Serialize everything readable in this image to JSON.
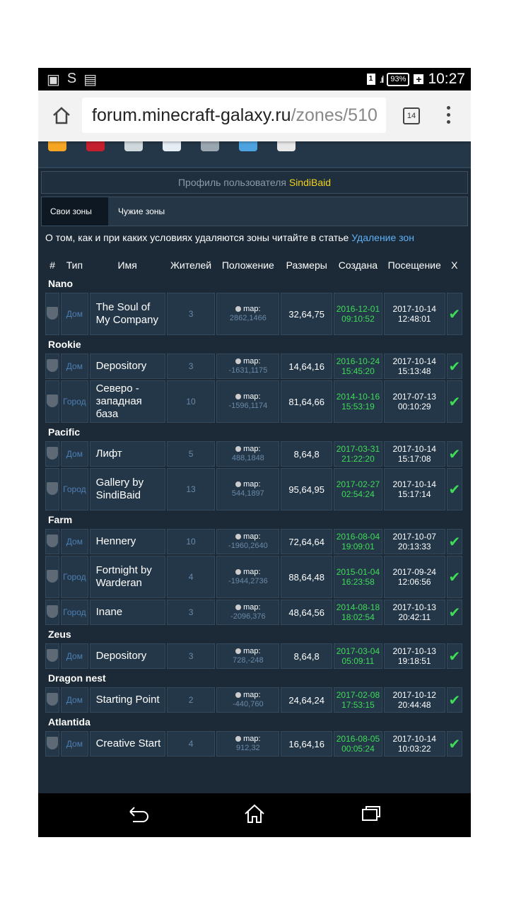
{
  "statusbar": {
    "battery": "93%",
    "time": "10:27",
    "sim": "1"
  },
  "browser": {
    "url_host": "forum.minecraft-galaxy.ru",
    "url_path": "/zones/510",
    "tab_count": "14"
  },
  "profile": {
    "prefix": "Профиль пользователя ",
    "username": "SindiBaid"
  },
  "tabs": {
    "own": "Свои зоны",
    "other": "Чужие зоны"
  },
  "notice": {
    "text": "О том, как и при каких условиях удаляются зоны читайте в статье ",
    "link": "Удаление зон"
  },
  "columns": {
    "num": "#",
    "type": "Тип",
    "name": "Имя",
    "residents": "Жителей",
    "position": "Положение",
    "size": "Размеры",
    "created": "Создана",
    "visit": "Посещение",
    "x": "X"
  },
  "groups": [
    {
      "name": "Nano",
      "zones": [
        {
          "type": "Дом",
          "name": "The Soul of My Company",
          "residents": "3",
          "pos_label": "map:",
          "pos_coord": "2862,1466",
          "size": "32,64,75",
          "created_date": "2016-12-01",
          "created_time": "09:10:52",
          "visit_date": "2017-10-14",
          "visit_time": "12:48:01"
        }
      ]
    },
    {
      "name": "Rookie",
      "zones": [
        {
          "type": "Дом",
          "name": "Depository",
          "residents": "3",
          "pos_label": "map:",
          "pos_coord": "-1631,1175",
          "size": "14,64,16",
          "created_date": "2016-10-24",
          "created_time": "15:45:20",
          "visit_date": "2017-10-14",
          "visit_time": "15:13:48"
        },
        {
          "type": "Город",
          "name": "Северо - западная база",
          "residents": "10",
          "pos_label": "map:",
          "pos_coord": "-1596,1174",
          "size": "81,64,66",
          "created_date": "2014-10-16",
          "created_time": "15:53:19",
          "visit_date": "2017-07-13",
          "visit_time": "00:10:29"
        }
      ]
    },
    {
      "name": "Pacific",
      "zones": [
        {
          "type": "Дом",
          "name": "Лифт",
          "residents": "5",
          "pos_label": "map:",
          "pos_coord": "488,1848",
          "size": "8,64,8",
          "created_date": "2017-03-31",
          "created_time": "21:22:20",
          "visit_date": "2017-10-14",
          "visit_time": "15:17:08"
        },
        {
          "type": "Город",
          "name": "Gallery by SindiBaid",
          "residents": "13",
          "pos_label": "map:",
          "pos_coord": "544,1897",
          "size": "95,64,95",
          "created_date": "2017-02-27",
          "created_time": "02:54:24",
          "visit_date": "2017-10-14",
          "visit_time": "15:17:14"
        }
      ]
    },
    {
      "name": "Farm",
      "zones": [
        {
          "type": "Дом",
          "name": "Hennery",
          "residents": "10",
          "pos_label": "map:",
          "pos_coord": "-1960,2640",
          "size": "72,64,64",
          "created_date": "2016-08-04",
          "created_time": "19:09:01",
          "visit_date": "2017-10-07",
          "visit_time": "20:13:33"
        },
        {
          "type": "Город",
          "name": "Fortnight by Warderan",
          "residents": "4",
          "pos_label": "map:",
          "pos_coord": "-1944,2736",
          "size": "88,64,48",
          "created_date": "2015-01-04",
          "created_time": "16:23:58",
          "visit_date": "2017-09-24",
          "visit_time": "12:06:56"
        },
        {
          "type": "Город",
          "name": "Inane",
          "residents": "3",
          "pos_label": "map:",
          "pos_coord": "-2096,376",
          "size": "48,64,56",
          "created_date": "2014-08-18",
          "created_time": "18:02:54",
          "visit_date": "2017-10-13",
          "visit_time": "20:42:11"
        }
      ]
    },
    {
      "name": "Zeus",
      "zones": [
        {
          "type": "Дом",
          "name": "Depository",
          "residents": "3",
          "pos_label": "map:",
          "pos_coord": "728,-248",
          "size": "8,64,8",
          "created_date": "2017-03-04",
          "created_time": "05:09:11",
          "visit_date": "2017-10-13",
          "visit_time": "19:18:51"
        }
      ]
    },
    {
      "name": "Dragon nest",
      "zones": [
        {
          "type": "Дом",
          "name": "Starting Point",
          "residents": "2",
          "pos_label": "map:",
          "pos_coord": "-440,760",
          "size": "24,64,24",
          "created_date": "2017-02-08",
          "created_time": "17:53:15",
          "visit_date": "2017-10-12",
          "visit_time": "20:44:48"
        }
      ]
    },
    {
      "name": "Atlantida",
      "zones": [
        {
          "type": "Дом",
          "name": "Creative Start",
          "residents": "4",
          "pos_label": "map:",
          "pos_coord": "912,32",
          "size": "16,64,16",
          "created_date": "2016-08-05",
          "created_time": "00:05:24",
          "visit_date": "2017-10-14",
          "visit_time": "10:03:22"
        }
      ]
    }
  ],
  "colors": {
    "created": "#3fdb57",
    "username": "#f2d21b",
    "link": "#5fb0f5"
  }
}
